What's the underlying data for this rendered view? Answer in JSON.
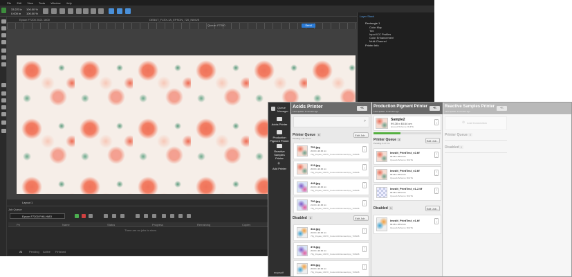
{
  "app": {
    "menu": [
      "File",
      "Edit",
      "View",
      "Tools",
      "Window",
      "Help"
    ],
    "dim_w": "33.223 in",
    "dim_h": "0.000 in",
    "zoom_x": "100.00 %",
    "zoom_y": "100.00 %",
    "doc_tab_1": "Epson F7200 2021 1600",
    "doc_tab_2": "DEBUT_FLEX-1A_EPSON_720_INMUS",
    "queue_label": "Queue: F7200",
    "send_btn": "Send",
    "layer_tab": "Layout 1",
    "job_queue_title": "Job Queue",
    "job_device": "Epson F7200 FH8-HMO",
    "job_columns": [
      "Pri",
      "Name",
      "Status",
      "Progress",
      "Remaining",
      "Copies",
      "Printed Length"
    ],
    "job_empty": "There are no jobs to show",
    "job_tabs": [
      "All",
      "Pending",
      "Active",
      "Finished"
    ]
  },
  "layer_panel": {
    "title": "Layer Stack",
    "items": [
      "Rectangle 1",
      "Color Map",
      "Tint",
      "Input ICC Profiles",
      "Color Enhancement",
      "Multi-Channel",
      "Printer Info"
    ]
  },
  "queue_manager": {
    "sidebar": {
      "title": "Queue Manager",
      "items": [
        "Acids Printer",
        "Production Pigment Printer",
        "Reactive Samples Printer",
        "Add Printer"
      ],
      "logo": "ergosoft"
    },
    "acids": {
      "title": "Acids Printer",
      "subtitle": "Last Update: 5 minutes ago",
      "btn": "≪",
      "printer_queue_label": "Printer Queue",
      "printer_queue_count": "6",
      "edit_label": "Edit Job...",
      "remaining": "Pending: 141.12 cm",
      "queue": [
        {
          "name": "752.jpg",
          "size": "20.00 x 20.00 cm",
          "info": "75g_Royale_CMYK_CustomOnDemand.tpq_708108"
        },
        {
          "name": "219.jpg",
          "size": "20.00 x 20.00 cm",
          "info": "75g_Royale_CMYK_CustomOnDemand.tpq_708108"
        },
        {
          "name": "448.jpg",
          "size": "20.00 x 20.00 cm",
          "info": "75g_Royale_CMYK_CustomOnDemand.tpq_708108"
        },
        {
          "name": "790.jpg",
          "size": "21.00 x 21.00 cm",
          "info": "75g_Royale_CMYK_CustomOnDemand.tpq_708108"
        }
      ],
      "disabled_label": "Disabled",
      "disabled_count": "3",
      "disabled": [
        {
          "name": "342.jpg",
          "size": "20.00 x 20.00 cm",
          "info": "75g_Royale_CMYK_CustomOnDemand.tpq_708108"
        },
        {
          "name": "378.jpg",
          "size": "20.00 x 20.00 cm",
          "info": "75g_Royale_CMYK_CustomOnDemand.tpq_708108"
        },
        {
          "name": "350.jpg",
          "size": "20.00 x 20.00 cm",
          "info": "75g_Royale_CMYK_CustomOnDemand.tpq_708108"
        }
      ]
    },
    "pigment": {
      "title": "Production Pigment Printer",
      "subtitle": "Last Update: 5 minutes ago",
      "btn": "≪",
      "current": {
        "name": "Sample2",
        "size": "99.28 x 48.64 cm",
        "info": "Queue1/Scheme: RHITE"
      },
      "progress": 0.4,
      "printer_queue_label": "Printer Queue",
      "printer_queue_count": "3",
      "edit_label": "Edit Job...",
      "remaining": "Pending: 0.17 cm",
      "queue": [
        {
          "name": "Imedit_PrintTest_v2.tif",
          "size": "99.28 x 48.64 cm",
          "info": "Queue1/Scheme: RHITE"
        },
        {
          "name": "Imedit_PrintTest_v2.tif",
          "size": "99.28 x 48.64 cm",
          "info": "Queue1/Scheme: RHITE"
        },
        {
          "name": "Imedit_PrintTest_v1-2.tif",
          "size": "99.28 x 48.64 cm",
          "info": "Queue1/Scheme: RHITE"
        }
      ],
      "disabled_label": "Disabled",
      "disabled_count": "1",
      "disabled": [
        {
          "name": "Imedit_PrintTest_v1.tif",
          "size": "99.28 x 48.64 cm",
          "info": "Queue1/Scheme: RHITE"
        }
      ]
    },
    "reactive": {
      "title": "Reactive Samples Printer",
      "subtitle": "Last Update: 5 minutes ago",
      "btn": "≪",
      "status": "Lost Connection",
      "printer_queue_label": "Printer Queue",
      "printer_queue_count": "0",
      "disabled_label": "Disabled",
      "disabled_count": "0"
    }
  },
  "colors": {
    "accent": "#2b7bd6",
    "dark_bg": "#2d2d2d",
    "panel_bg": "#f0f0f0",
    "header_bg": "#6a6a6a",
    "progress": "#55b040"
  }
}
